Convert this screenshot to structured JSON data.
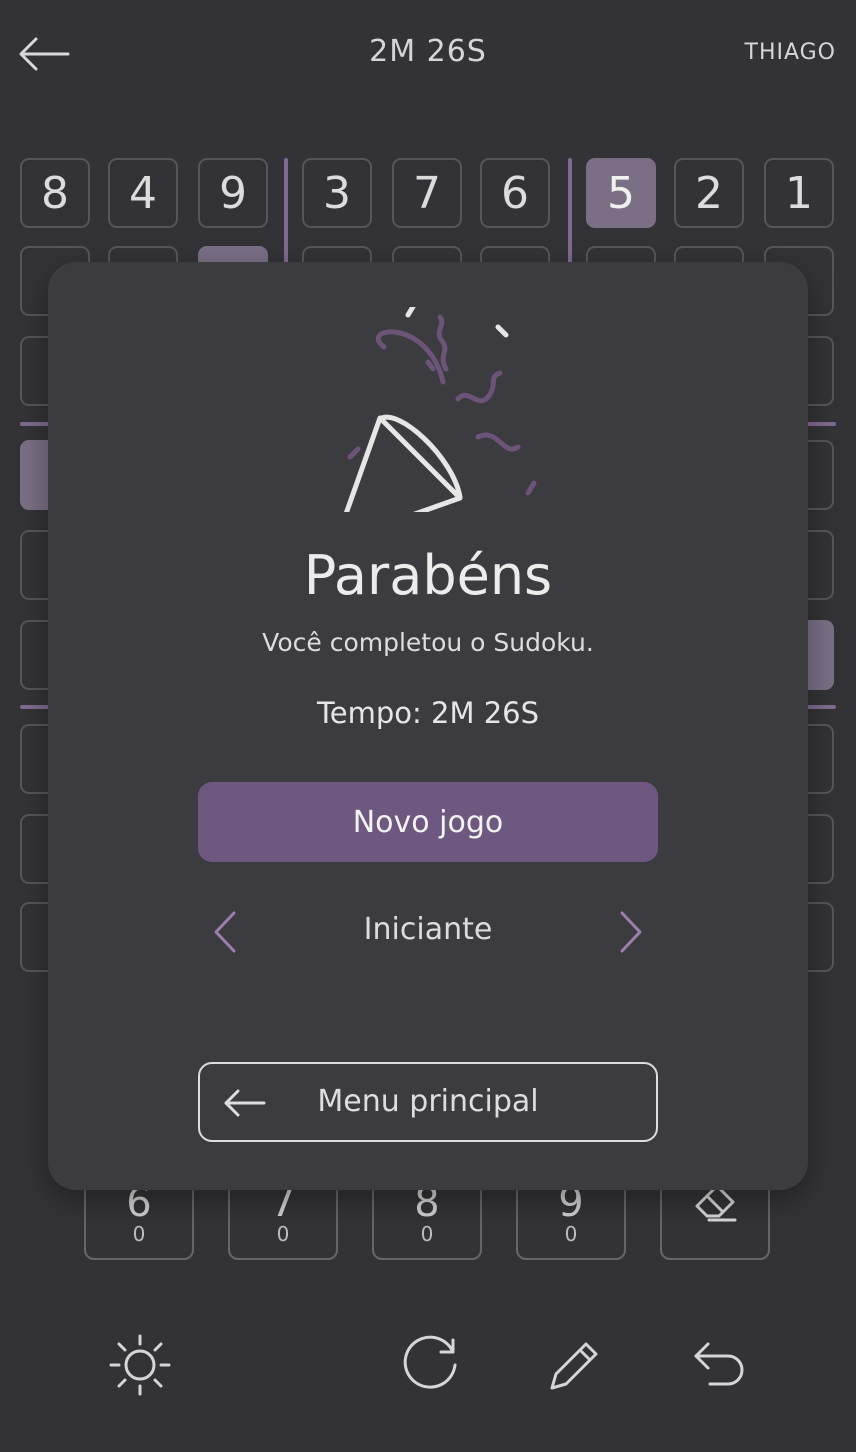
{
  "header": {
    "timer": "2M 26S",
    "user": "THIAGO"
  },
  "board": {
    "row1": [
      "8",
      "4",
      "9",
      "3",
      "7",
      "6",
      "5",
      "2",
      "1"
    ],
    "selected_value": "5"
  },
  "numpad": [
    {
      "digit": "6",
      "count": "0"
    },
    {
      "digit": "7",
      "count": "0"
    },
    {
      "digit": "8",
      "count": "0"
    },
    {
      "digit": "9",
      "count": "0"
    }
  ],
  "modal": {
    "title": "Parabéns",
    "subtitle": "Você completou o Sudoku.",
    "time": "Tempo: 2M 26S",
    "new_game_label": "Novo jogo",
    "difficulty": "Iniciante",
    "main_menu_label": "Menu principal"
  },
  "colors": {
    "accent": "#6f5880",
    "selected_cell": "#7a6f85",
    "background": "#333236",
    "modal_bg": "#3c3b3f"
  },
  "icons": {
    "back": "arrow-left-icon",
    "party": "party-popper-icon",
    "theme": "sun-icon",
    "restart": "refresh-icon",
    "notes": "pencil-icon",
    "undo": "undo-icon",
    "erase": "eraser-icon"
  }
}
